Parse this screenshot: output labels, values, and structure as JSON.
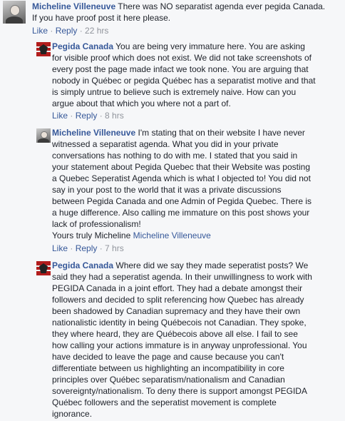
{
  "comments": [
    {
      "author": "Micheline Villeneuve",
      "text": " There was NO separatist agenda ever pegida Canada.\nIf you have proof post it here please.",
      "like_label": "Like",
      "reply_label": "Reply",
      "time": "22 hrs"
    },
    {
      "author": "Pegida Canada",
      "text": " You are being very immature here. You are asking\nfor visible proof which does not exist. We did not take screenshots of\nevery post the page made infact we took none. You are arguing that\nnobody in Québec or pegida Québec has a separatist motive and that\nis simply untrue to believe such is extremely naive. How can you\nargue about that which you where not a part of.",
      "like_label": "Like",
      "reply_label": "Reply",
      "time": "8 hrs"
    },
    {
      "author": "Micheline Villeneuve",
      "text": " I'm stating that on their website I have never\nwitnessed a separatist agenda. What you did in your private\nconversations has nothing to do with me. I stated that you said in\nyour statement about Pegida Quebec that their Website was posting\na Quebec Seperatist Agenda which is what I objected to! You did not\nsay in your post to the world that it was a private discussions\nbetween Pegida Canada and one Admin of Pegida Quebec. There is\na huge difference. Also calling me immature on this post shows your\nlack of professionalism!\nYours truly Micheline ",
      "mention": "Micheline Villeneuve",
      "like_label": "Like",
      "reply_label": "Reply",
      "time": "7 hrs"
    },
    {
      "author": "Pegida Canada",
      "text": " Where did we say they made seperatist posts? We\nsaid they had a seperatist agenda. In their unwillingness to work with\nPEGIDA Canada in a joint effort. They had a debate amongst their\nfollowers and decided to split referencing how Quebec has already\nbeen shadowed by Canadian supremacy and they have their own\nnationalistic identity in being Québecois not Canadian. They spoke,\nthey where heard, they are Québecois above all else. I fail to see\nhow calling your actions immature is in anyway unprofessional. You\nhave decided to leave the page and cause because you can't\ndifferentiate between us highlighting an incompatibility in core\nprinciples over Québec separatism/nationalism and Canadian\nsovereignty/nationalism. To deny there is support amongst PEGIDA\nQuébec followers and the seperatist movement is complete\nignorance."
    }
  ]
}
